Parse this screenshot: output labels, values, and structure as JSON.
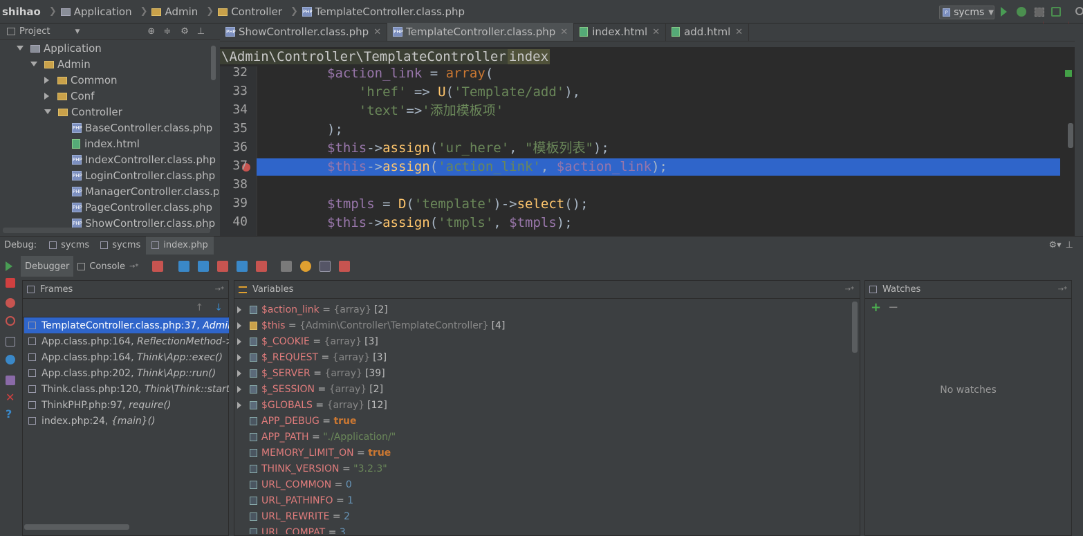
{
  "breadcrumbs": [
    "shihao",
    "Application",
    "Admin",
    "Controller",
    "TemplateController.class.php"
  ],
  "run_config": "sycms",
  "sidebar": {
    "tab_label": "Project"
  },
  "project_tree": [
    {
      "label": "Application",
      "kind": "folder",
      "state": "expanded",
      "depth": 0
    },
    {
      "label": "Admin",
      "kind": "folder",
      "state": "expanded",
      "depth": 1
    },
    {
      "label": "Common",
      "kind": "folder",
      "state": "collapsed",
      "depth": 2
    },
    {
      "label": "Conf",
      "kind": "folder",
      "state": "collapsed",
      "depth": 2
    },
    {
      "label": "Controller",
      "kind": "folder",
      "state": "expanded",
      "depth": 2
    },
    {
      "label": "BaseController.class.php",
      "kind": "php",
      "depth": 3
    },
    {
      "label": "index.html",
      "kind": "html",
      "depth": 3
    },
    {
      "label": "IndexController.class.php",
      "kind": "php",
      "depth": 3
    },
    {
      "label": "LoginController.class.php",
      "kind": "php",
      "depth": 3
    },
    {
      "label": "ManagerController.class.ph",
      "kind": "php",
      "depth": 3
    },
    {
      "label": "PageController.class.php",
      "kind": "php",
      "depth": 3
    },
    {
      "label": "ShowController.class.php",
      "kind": "php",
      "depth": 3
    }
  ],
  "editor_tabs": [
    {
      "label": "ShowController.class.php",
      "icon": "php-file-icon",
      "active": false
    },
    {
      "label": "TemplateController.class.php",
      "icon": "php-file-icon",
      "active": true
    },
    {
      "label": "index.html",
      "icon": "html-file-icon",
      "active": false
    },
    {
      "label": "add.html",
      "icon": "html-file-icon",
      "active": false
    }
  ],
  "editor": {
    "path_namespace": "\\Admin\\Controller\\TemplateController",
    "path_method": "index",
    "line_numbers": [
      "32",
      "33",
      "34",
      "35",
      "36",
      "37",
      "38",
      "39",
      "40"
    ],
    "breakpoint_line": "37",
    "lines": [
      [
        {
          "t": "$action_link",
          "c": "var"
        },
        {
          "t": " = ",
          "c": ""
        },
        {
          "t": "array",
          "c": "kw"
        },
        {
          "t": "(",
          "c": ""
        }
      ],
      [
        {
          "t": "    'href'",
          "c": "str"
        },
        {
          "t": " => ",
          "c": ""
        },
        {
          "t": "U",
          "c": "fn"
        },
        {
          "t": "(",
          "c": ""
        },
        {
          "t": "'Template/add'",
          "c": "str"
        },
        {
          "t": "),",
          "c": ""
        }
      ],
      [
        {
          "t": "    'text'",
          "c": "str"
        },
        {
          "t": "=>",
          "c": ""
        },
        {
          "t": "'添加模板项'",
          "c": "str"
        }
      ],
      [
        {
          "t": ");",
          "c": ""
        }
      ],
      [
        {
          "t": "$this",
          "c": "var"
        },
        {
          "t": "->",
          "c": ""
        },
        {
          "t": "assign",
          "c": "fn"
        },
        {
          "t": "(",
          "c": ""
        },
        {
          "t": "'ur_here'",
          "c": "str"
        },
        {
          "t": ", ",
          "c": ""
        },
        {
          "t": "\"模板列表\"",
          "c": "str"
        },
        {
          "t": ");",
          "c": ""
        }
      ],
      [
        {
          "t": "$this",
          "c": "var"
        },
        {
          "t": "->",
          "c": ""
        },
        {
          "t": "assign",
          "c": "fn"
        },
        {
          "t": "(",
          "c": ""
        },
        {
          "t": "'action_link'",
          "c": "str"
        },
        {
          "t": ", ",
          "c": ""
        },
        {
          "t": "$action_link",
          "c": "var"
        },
        {
          "t": ");",
          "c": ""
        }
      ],
      [],
      [
        {
          "t": "$tmpls",
          "c": "var"
        },
        {
          "t": " = ",
          "c": ""
        },
        {
          "t": "D",
          "c": "fn"
        },
        {
          "t": "(",
          "c": ""
        },
        {
          "t": "'template'",
          "c": "str"
        },
        {
          "t": ")->",
          "c": ""
        },
        {
          "t": "select",
          "c": "fn"
        },
        {
          "t": "();",
          "c": ""
        }
      ],
      [
        {
          "t": "$this",
          "c": "var"
        },
        {
          "t": "->",
          "c": ""
        },
        {
          "t": "assign",
          "c": "fn"
        },
        {
          "t": "(",
          "c": ""
        },
        {
          "t": "'tmpls'",
          "c": "str"
        },
        {
          "t": ", ",
          "c": ""
        },
        {
          "t": "$tmpls",
          "c": "var"
        },
        {
          "t": ");",
          "c": ""
        }
      ]
    ]
  },
  "debug": {
    "label": "Debug:",
    "sessions": [
      "sycms",
      "sycms",
      "index.php"
    ],
    "tabs": [
      "Debugger",
      "Console"
    ],
    "frames_title": "Frames",
    "frames": [
      {
        "loc": "TemplateController.class.php:37, ",
        "fn": "Admin\\",
        "selected": true
      },
      {
        "loc": "App.class.php:164, ",
        "fn": "ReflectionMethod->i",
        "selected": false
      },
      {
        "loc": "App.class.php:164, ",
        "fn": "Think\\App::exec()",
        "selected": false
      },
      {
        "loc": "App.class.php:202, ",
        "fn": "Think\\App::run()",
        "selected": false
      },
      {
        "loc": "Think.class.php:120, ",
        "fn": "Think\\Think::start()",
        "selected": false
      },
      {
        "loc": "ThinkPHP.php:97, ",
        "fn": "require()",
        "selected": false
      },
      {
        "loc": "index.php:24, ",
        "fn": "{main}()",
        "selected": false
      }
    ],
    "variables_title": "Variables",
    "variables": [
      {
        "name": "$action_link",
        "type": "{array}",
        "value": "[2]",
        "kind": "arr",
        "expandable": true
      },
      {
        "name": "$this",
        "type": "{Admin\\Controller\\TemplateController}",
        "value": "[4]",
        "kind": "obj",
        "expandable": true
      },
      {
        "name": "$_COOKIE",
        "type": "{array}",
        "value": "[3]",
        "kind": "arr",
        "expandable": true
      },
      {
        "name": "$_REQUEST",
        "type": "{array}",
        "value": "[3]",
        "kind": "arr",
        "expandable": true
      },
      {
        "name": "$_SERVER",
        "type": "{array}",
        "value": "[39]",
        "kind": "arr",
        "expandable": true
      },
      {
        "name": "$_SESSION",
        "type": "{array}",
        "value": "[2]",
        "kind": "arr",
        "expandable": true
      },
      {
        "name": "$GLOBALS",
        "type": "{array}",
        "value": "[12]",
        "kind": "arr",
        "expandable": true
      },
      {
        "name": "APP_DEBUG",
        "type": "",
        "value": "true",
        "kind": "bool",
        "expandable": false
      },
      {
        "name": "APP_PATH",
        "type": "",
        "value": "\"./Application/\"",
        "kind": "str",
        "expandable": false
      },
      {
        "name": "MEMORY_LIMIT_ON",
        "type": "",
        "value": "true",
        "kind": "bool",
        "expandable": false
      },
      {
        "name": "THINK_VERSION",
        "type": "",
        "value": "\"3.2.3\"",
        "kind": "str",
        "expandable": false
      },
      {
        "name": "URL_COMMON",
        "type": "",
        "value": "0",
        "kind": "num",
        "expandable": false
      },
      {
        "name": "URL_PATHINFO",
        "type": "",
        "value": "1",
        "kind": "num",
        "expandable": false
      },
      {
        "name": "URL_REWRITE",
        "type": "",
        "value": "2",
        "kind": "num",
        "expandable": false
      },
      {
        "name": "URL_COMPAT",
        "type": "",
        "value": "3",
        "kind": "num",
        "expandable": false
      }
    ],
    "watches_title": "Watches",
    "watches_empty": "No watches"
  },
  "colors": {
    "selection": "#2f65ca",
    "breakpoint": "#c75450",
    "run": "#499c54"
  }
}
